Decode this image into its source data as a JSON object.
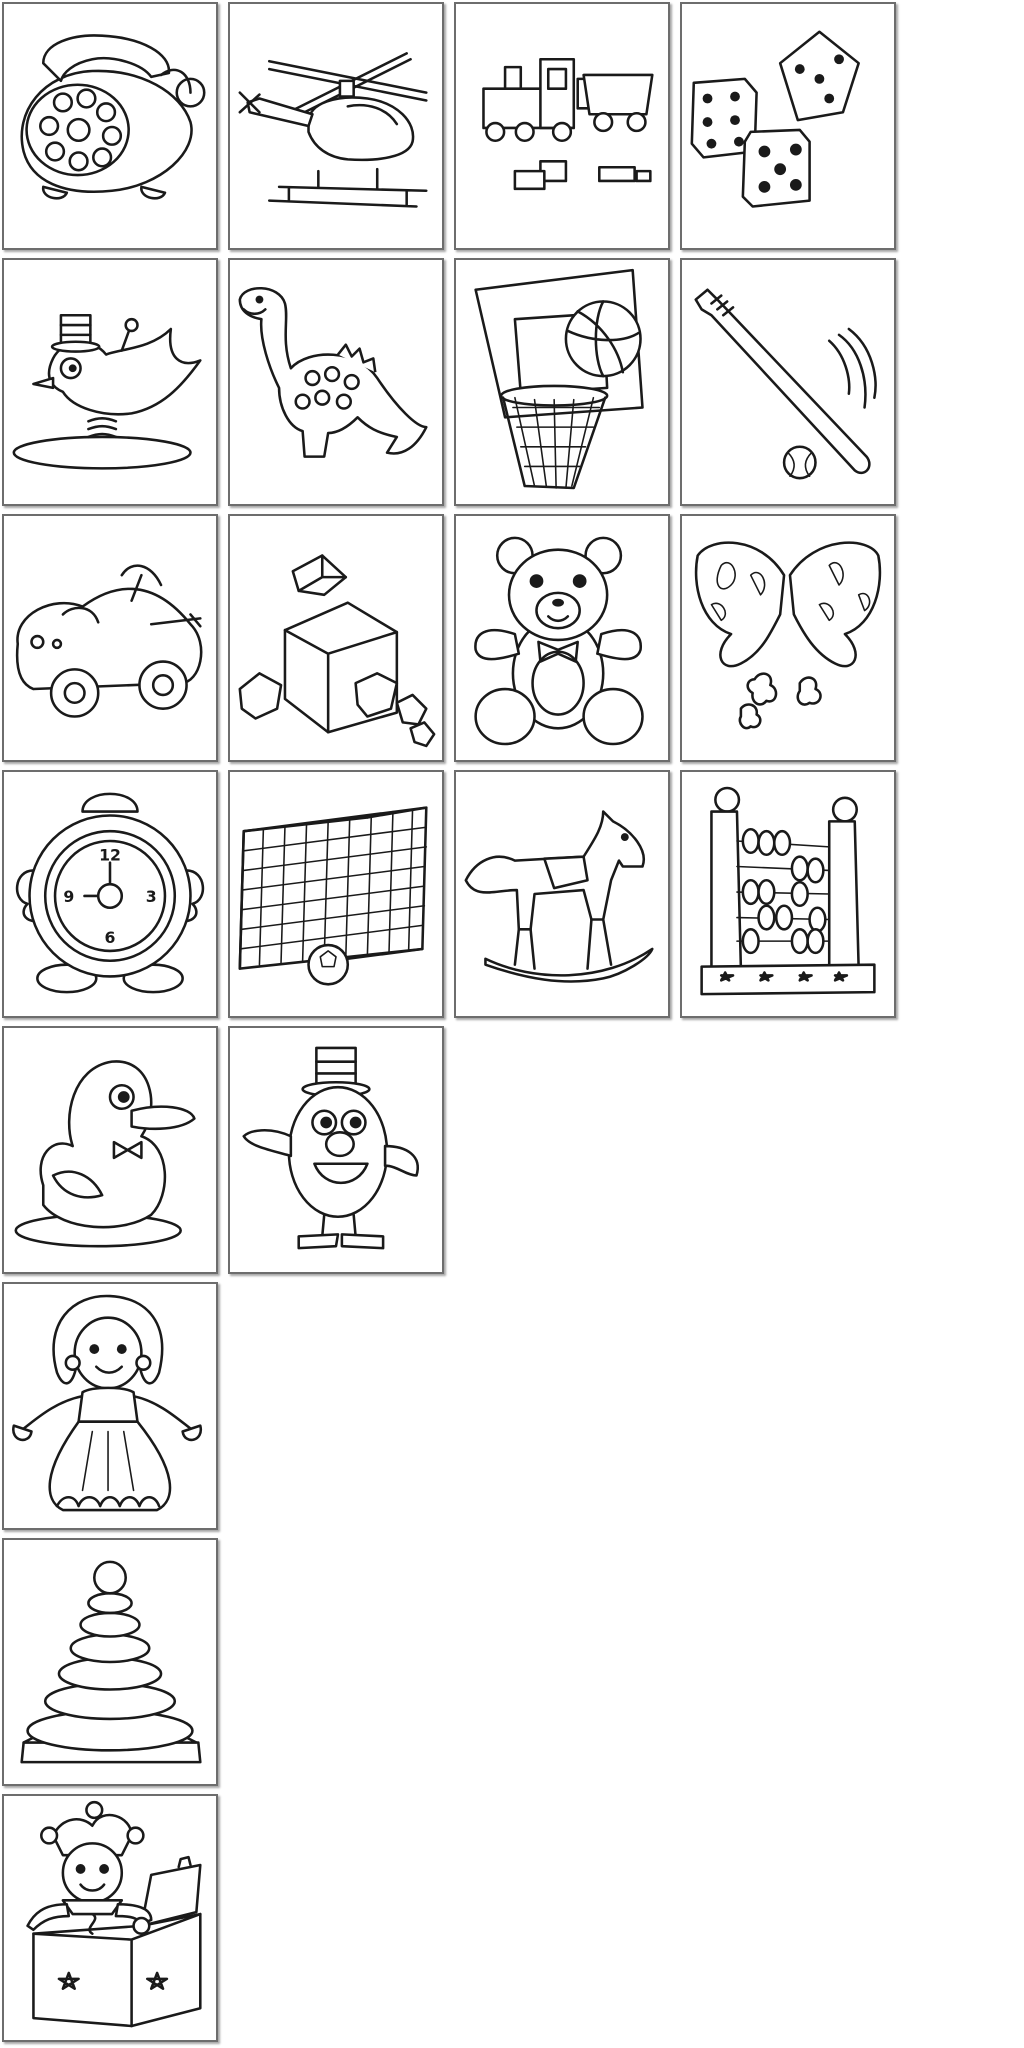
{
  "cards": [
    {
      "icon": "toy-telephone-icon"
    },
    {
      "icon": "toy-helicopter-icon"
    },
    {
      "icon": "toy-train-icon"
    },
    {
      "icon": "dice-icon"
    },
    {
      "icon": "wind-up-bird-icon"
    },
    {
      "icon": "dinosaur-icon"
    },
    {
      "icon": "basketball-hoop-icon"
    },
    {
      "icon": "baseball-bat-icon"
    },
    {
      "icon": "toy-car-icon"
    },
    {
      "icon": "building-blocks-icon"
    },
    {
      "icon": "teddy-bear-icon"
    },
    {
      "icon": "butterfly-puzzle-icon"
    },
    {
      "icon": "alarm-clock-icon"
    },
    {
      "icon": "soccer-goal-icon"
    },
    {
      "icon": "rocking-horse-icon"
    },
    {
      "icon": "abacus-icon"
    },
    {
      "icon": "rubber-duck-icon"
    },
    {
      "icon": "potato-head-icon"
    },
    {
      "icon": "doll-icon"
    },
    {
      "icon": "stacking-rings-icon"
    },
    {
      "icon": "jack-in-the-box-icon"
    }
  ],
  "clock": {
    "n12": "12",
    "n3": "3",
    "n6": "6",
    "n9": "9"
  }
}
